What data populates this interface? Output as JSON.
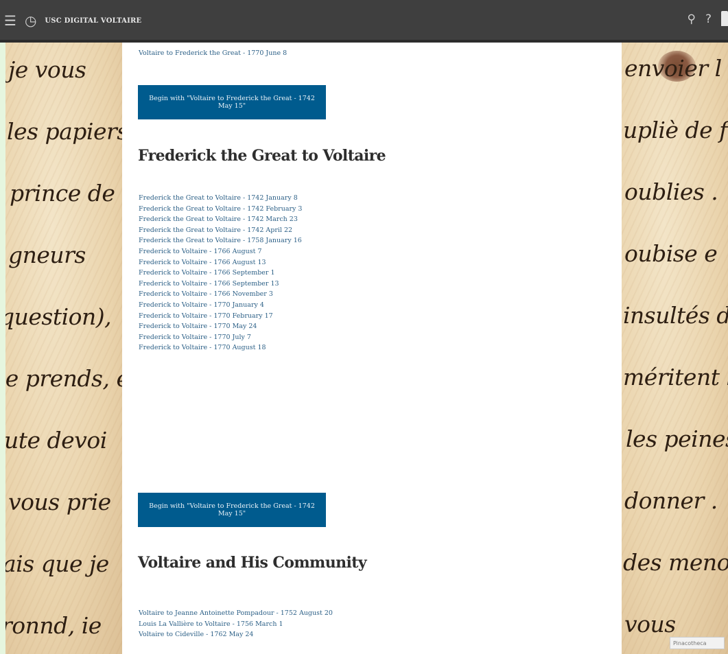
{
  "header": {
    "title": "USC DIGITAL VOLTAIRE",
    "icons": [
      "menu-icon",
      "history-icon",
      "search-icon",
      "help-icon",
      "bookmark-icon"
    ]
  },
  "main": {
    "top_link": "Voltaire to Frederick the Great - 1770 June 8",
    "begin_button_1": "Begin with \"Voltaire to Frederick the Great - 1742 May 15\"",
    "section_frederick": {
      "heading": "Frederick the Great to Voltaire",
      "links": [
        "Frederick the Great to Voltaire - 1742 January 8",
        "Frederick the Great to Voltaire - 1742 February 3",
        "Frederick the Great to Voltaire - 1742 March 23",
        "Frederick the Great to Voltaire - 1742 April 22",
        "Frederick the Great to Voltaire - 1758 January 16",
        "Frederick to Voltaire - 1766 August 7",
        "Frederick to Voltaire - 1766 August 13",
        "Frederick to Voltaire - 1766 September 1",
        "Frederick to Voltaire - 1766 September 13",
        "Frederick to Voltaire - 1766 November 3",
        "Frederick to Voltaire - 1770 January 4",
        "Frederick to Voltaire - 1770 February 17",
        "Frederick to Voltaire - 1770 May 24",
        "Frederick to Voltaire - 1770 July 7",
        "Frederick to Voltaire - 1770 August 18"
      ]
    },
    "begin_button_2": "Begin with \"Voltaire to Frederick the Great - 1742 May 15\"",
    "section_community": {
      "heading": "Voltaire and His Community",
      "links": [
        "Voltaire to Jeanne Antoinette Pompadour - 1752 August 20",
        "Louis La Vallière to Voltaire - 1756 March 1",
        "Voltaire to Cideville - 1762 May 24"
      ]
    }
  },
  "manuscript": {
    "left_lines": [
      "je vous",
      "les papiers",
      "prince de",
      "gneurs",
      "question),",
      "je prends, e",
      "ute devoi",
      "vous prie",
      "ais que je",
      "ronnd, ie"
    ],
    "right_lines": [
      "envoier l",
      "upliè de fa",
      "oublies .",
      "oubise e",
      "insultés d",
      "méritent l",
      "les peines q",
      "donner .",
      "des menoi",
      "vous"
    ],
    "stamp_text": "Pinacotheca"
  }
}
